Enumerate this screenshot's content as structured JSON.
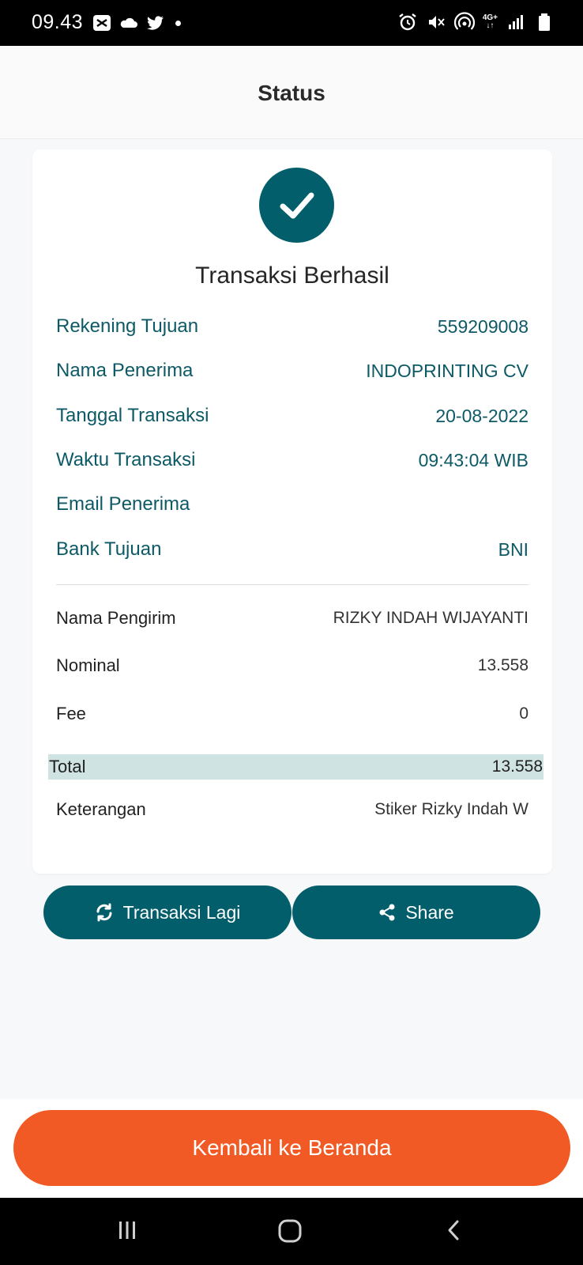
{
  "status_bar": {
    "time": "09.43",
    "network": "4G+"
  },
  "header": {
    "title": "Status"
  },
  "result": {
    "title": "Transaksi Berhasil",
    "recipient_rows": [
      {
        "label": "Rekening Tujuan",
        "value": "559209008"
      },
      {
        "label": "Nama Penerima",
        "value": "INDOPRINTING CV"
      },
      {
        "label": "Tanggal Transaksi",
        "value": "20-08-2022"
      },
      {
        "label": "Waktu Transaksi",
        "value": "09:43:04 WIB"
      },
      {
        "label": "Email Penerima",
        "value": ""
      },
      {
        "label": "Bank Tujuan",
        "value": "BNI"
      }
    ],
    "detail_rows": [
      {
        "label": "Nama Pengirim",
        "value": "RIZKY INDAH WIJAYANTI"
      },
      {
        "label": "Nominal",
        "value": "13.558"
      },
      {
        "label": "Fee",
        "value": "0"
      }
    ],
    "total": {
      "label": "Total",
      "value": "13.558"
    },
    "note": {
      "label": "Keterangan",
      "value": "Stiker Rizky Indah W"
    }
  },
  "actions": {
    "again_label": "Transaksi Lagi",
    "share_label": "Share",
    "home_label": "Kembali ke Beranda"
  },
  "colors": {
    "primary": "#025e6a",
    "accent": "#f15a24",
    "total_highlight": "#cfe3e2"
  }
}
